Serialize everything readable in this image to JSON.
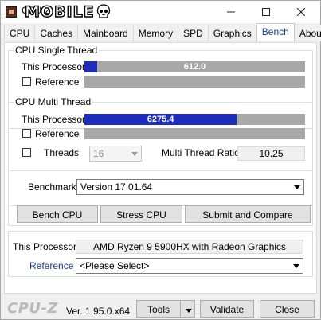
{
  "window": {
    "title": "CPU-Z",
    "watermark": "MOBILE"
  },
  "tabs": [
    {
      "label": "CPU"
    },
    {
      "label": "Caches"
    },
    {
      "label": "Mainboard"
    },
    {
      "label": "Memory"
    },
    {
      "label": "SPD"
    },
    {
      "label": "Graphics"
    },
    {
      "label": "Bench"
    },
    {
      "label": "About"
    }
  ],
  "active_tab": "Bench",
  "single_thread": {
    "title": "CPU Single Thread",
    "this_processor_label": "This Processor",
    "this_processor_value": "612.0",
    "this_processor_fraction": 0.058,
    "reference_label": "Reference"
  },
  "multi_thread": {
    "title": "CPU Multi Thread",
    "this_processor_label": "This Processor",
    "this_processor_value": "6275.4",
    "this_processor_fraction": 0.69,
    "reference_label": "Reference",
    "threads_label": "Threads",
    "threads_value": "16",
    "ratio_label": "Multi Thread Ratio",
    "ratio_value": "10.25"
  },
  "benchmark": {
    "label": "Benchmark",
    "version": "Version 17.01.64",
    "bench_cpu": "Bench CPU",
    "stress_cpu": "Stress CPU",
    "submit": "Submit and Compare"
  },
  "processor_info": {
    "this_processor_label": "This Processor",
    "this_processor_value": "AMD Ryzen 9 5900HX with Radeon Graphics",
    "reference_label": "Reference",
    "reference_placeholder": "<Please Select>"
  },
  "footer": {
    "logo": "CPU-Z",
    "version": "Ver. 1.95.0.x64",
    "tools": "Tools",
    "validate": "Validate",
    "close": "Close"
  },
  "colors": {
    "bar_fill": "#1e2cbd",
    "bar_empty": "#a8a8a8",
    "active_tab_text": "#1a3d9c",
    "reference_link": "#1a3d9c"
  }
}
